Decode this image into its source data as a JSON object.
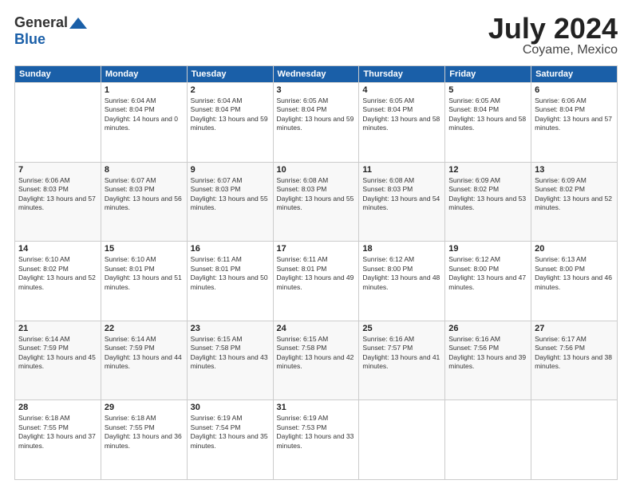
{
  "logo": {
    "general": "General",
    "blue": "Blue"
  },
  "header": {
    "month": "July 2024",
    "location": "Coyame, Mexico"
  },
  "days_of_week": [
    "Sunday",
    "Monday",
    "Tuesday",
    "Wednesday",
    "Thursday",
    "Friday",
    "Saturday"
  ],
  "weeks": [
    [
      {
        "day": "",
        "sunrise": "",
        "sunset": "",
        "daylight": ""
      },
      {
        "day": "1",
        "sunrise": "Sunrise: 6:04 AM",
        "sunset": "Sunset: 8:04 PM",
        "daylight": "Daylight: 14 hours and 0 minutes."
      },
      {
        "day": "2",
        "sunrise": "Sunrise: 6:04 AM",
        "sunset": "Sunset: 8:04 PM",
        "daylight": "Daylight: 13 hours and 59 minutes."
      },
      {
        "day": "3",
        "sunrise": "Sunrise: 6:05 AM",
        "sunset": "Sunset: 8:04 PM",
        "daylight": "Daylight: 13 hours and 59 minutes."
      },
      {
        "day": "4",
        "sunrise": "Sunrise: 6:05 AM",
        "sunset": "Sunset: 8:04 PM",
        "daylight": "Daylight: 13 hours and 58 minutes."
      },
      {
        "day": "5",
        "sunrise": "Sunrise: 6:05 AM",
        "sunset": "Sunset: 8:04 PM",
        "daylight": "Daylight: 13 hours and 58 minutes."
      },
      {
        "day": "6",
        "sunrise": "Sunrise: 6:06 AM",
        "sunset": "Sunset: 8:04 PM",
        "daylight": "Daylight: 13 hours and 57 minutes."
      }
    ],
    [
      {
        "day": "7",
        "sunrise": "Sunrise: 6:06 AM",
        "sunset": "Sunset: 8:03 PM",
        "daylight": "Daylight: 13 hours and 57 minutes."
      },
      {
        "day": "8",
        "sunrise": "Sunrise: 6:07 AM",
        "sunset": "Sunset: 8:03 PM",
        "daylight": "Daylight: 13 hours and 56 minutes."
      },
      {
        "day": "9",
        "sunrise": "Sunrise: 6:07 AM",
        "sunset": "Sunset: 8:03 PM",
        "daylight": "Daylight: 13 hours and 55 minutes."
      },
      {
        "day": "10",
        "sunrise": "Sunrise: 6:08 AM",
        "sunset": "Sunset: 8:03 PM",
        "daylight": "Daylight: 13 hours and 55 minutes."
      },
      {
        "day": "11",
        "sunrise": "Sunrise: 6:08 AM",
        "sunset": "Sunset: 8:03 PM",
        "daylight": "Daylight: 13 hours and 54 minutes."
      },
      {
        "day": "12",
        "sunrise": "Sunrise: 6:09 AM",
        "sunset": "Sunset: 8:02 PM",
        "daylight": "Daylight: 13 hours and 53 minutes."
      },
      {
        "day": "13",
        "sunrise": "Sunrise: 6:09 AM",
        "sunset": "Sunset: 8:02 PM",
        "daylight": "Daylight: 13 hours and 52 minutes."
      }
    ],
    [
      {
        "day": "14",
        "sunrise": "Sunrise: 6:10 AM",
        "sunset": "Sunset: 8:02 PM",
        "daylight": "Daylight: 13 hours and 52 minutes."
      },
      {
        "day": "15",
        "sunrise": "Sunrise: 6:10 AM",
        "sunset": "Sunset: 8:01 PM",
        "daylight": "Daylight: 13 hours and 51 minutes."
      },
      {
        "day": "16",
        "sunrise": "Sunrise: 6:11 AM",
        "sunset": "Sunset: 8:01 PM",
        "daylight": "Daylight: 13 hours and 50 minutes."
      },
      {
        "day": "17",
        "sunrise": "Sunrise: 6:11 AM",
        "sunset": "Sunset: 8:01 PM",
        "daylight": "Daylight: 13 hours and 49 minutes."
      },
      {
        "day": "18",
        "sunrise": "Sunrise: 6:12 AM",
        "sunset": "Sunset: 8:00 PM",
        "daylight": "Daylight: 13 hours and 48 minutes."
      },
      {
        "day": "19",
        "sunrise": "Sunrise: 6:12 AM",
        "sunset": "Sunset: 8:00 PM",
        "daylight": "Daylight: 13 hours and 47 minutes."
      },
      {
        "day": "20",
        "sunrise": "Sunrise: 6:13 AM",
        "sunset": "Sunset: 8:00 PM",
        "daylight": "Daylight: 13 hours and 46 minutes."
      }
    ],
    [
      {
        "day": "21",
        "sunrise": "Sunrise: 6:14 AM",
        "sunset": "Sunset: 7:59 PM",
        "daylight": "Daylight: 13 hours and 45 minutes."
      },
      {
        "day": "22",
        "sunrise": "Sunrise: 6:14 AM",
        "sunset": "Sunset: 7:59 PM",
        "daylight": "Daylight: 13 hours and 44 minutes."
      },
      {
        "day": "23",
        "sunrise": "Sunrise: 6:15 AM",
        "sunset": "Sunset: 7:58 PM",
        "daylight": "Daylight: 13 hours and 43 minutes."
      },
      {
        "day": "24",
        "sunrise": "Sunrise: 6:15 AM",
        "sunset": "Sunset: 7:58 PM",
        "daylight": "Daylight: 13 hours and 42 minutes."
      },
      {
        "day": "25",
        "sunrise": "Sunrise: 6:16 AM",
        "sunset": "Sunset: 7:57 PM",
        "daylight": "Daylight: 13 hours and 41 minutes."
      },
      {
        "day": "26",
        "sunrise": "Sunrise: 6:16 AM",
        "sunset": "Sunset: 7:56 PM",
        "daylight": "Daylight: 13 hours and 39 minutes."
      },
      {
        "day": "27",
        "sunrise": "Sunrise: 6:17 AM",
        "sunset": "Sunset: 7:56 PM",
        "daylight": "Daylight: 13 hours and 38 minutes."
      }
    ],
    [
      {
        "day": "28",
        "sunrise": "Sunrise: 6:18 AM",
        "sunset": "Sunset: 7:55 PM",
        "daylight": "Daylight: 13 hours and 37 minutes."
      },
      {
        "day": "29",
        "sunrise": "Sunrise: 6:18 AM",
        "sunset": "Sunset: 7:55 PM",
        "daylight": "Daylight: 13 hours and 36 minutes."
      },
      {
        "day": "30",
        "sunrise": "Sunrise: 6:19 AM",
        "sunset": "Sunset: 7:54 PM",
        "daylight": "Daylight: 13 hours and 35 minutes."
      },
      {
        "day": "31",
        "sunrise": "Sunrise: 6:19 AM",
        "sunset": "Sunset: 7:53 PM",
        "daylight": "Daylight: 13 hours and 33 minutes."
      },
      {
        "day": "",
        "sunrise": "",
        "sunset": "",
        "daylight": ""
      },
      {
        "day": "",
        "sunrise": "",
        "sunset": "",
        "daylight": ""
      },
      {
        "day": "",
        "sunrise": "",
        "sunset": "",
        "daylight": ""
      }
    ]
  ]
}
